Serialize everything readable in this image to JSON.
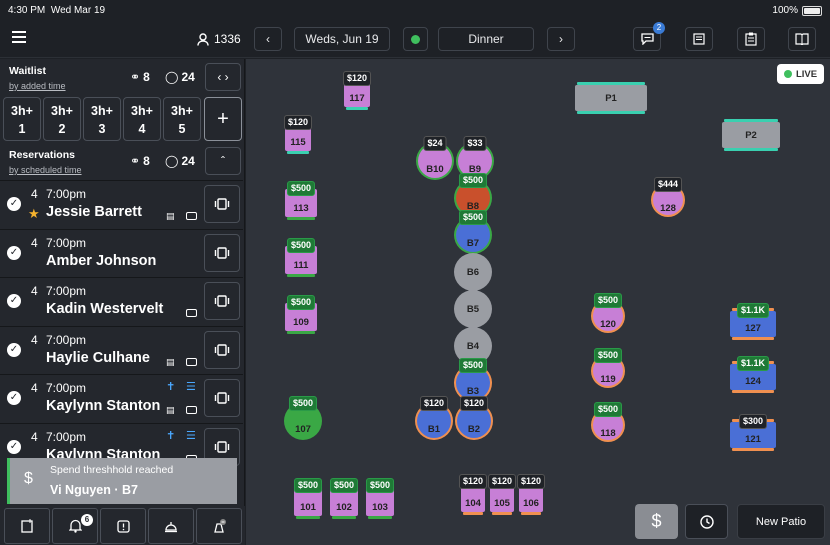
{
  "status": {
    "time": "4:30 PM",
    "date": "Wed Mar 19",
    "battery": "100%"
  },
  "topbar": {
    "menu_icon": "hamburger-icon",
    "covers": "1336",
    "date": "Weds, Jun 19",
    "service": "Dinner",
    "notif_badge": "2"
  },
  "waitlist": {
    "title": "Waitlist",
    "sort": "by added time",
    "parties": "8",
    "covers": "24",
    "slots": [
      {
        "top": "3h+",
        "bottom": "1"
      },
      {
        "top": "3h+",
        "bottom": "2"
      },
      {
        "top": "3h+",
        "bottom": "3"
      },
      {
        "top": "3h+",
        "bottom": "4"
      },
      {
        "top": "3h+",
        "bottom": "5"
      }
    ],
    "add": "+"
  },
  "reservations": {
    "title": "Reservations",
    "sort": "by scheduled time",
    "parties": "8",
    "covers": "24",
    "items": [
      {
        "size": "4",
        "time": "7:00pm",
        "name": "Jessie Barrett"
      },
      {
        "size": "4",
        "time": "7:00pm",
        "name": "Amber Johnson"
      },
      {
        "size": "4",
        "time": "7:00pm",
        "name": "Kadin Westervelt"
      },
      {
        "size": "4",
        "time": "7:00pm",
        "name": "Haylie Culhane"
      },
      {
        "size": "4",
        "time": "7:00pm",
        "name": "Kaylynn Stanton"
      },
      {
        "size": "4",
        "time": "7:00pm",
        "name": "Kaylynn Stanton"
      }
    ]
  },
  "toast": {
    "title": "Spend threshhold reached",
    "detail": "Vi Nguyen · B7",
    "icon": "$"
  },
  "bottomnav": {
    "badge": "6"
  },
  "floor": {
    "live": "LIVE",
    "tables": [
      {
        "id": "117",
        "price": "$120"
      },
      {
        "id": "115",
        "price": "$120"
      },
      {
        "id": "P1",
        "price": ""
      },
      {
        "id": "P2",
        "price": ""
      },
      {
        "id": "B10",
        "price": "$24"
      },
      {
        "id": "B9",
        "price": "$33"
      },
      {
        "id": "B8",
        "price": "$500"
      },
      {
        "id": "B7",
        "price": "$500"
      },
      {
        "id": "B6",
        "price": ""
      },
      {
        "id": "B5",
        "price": ""
      },
      {
        "id": "B4",
        "price": ""
      },
      {
        "id": "B3",
        "price": "$500"
      },
      {
        "id": "B1",
        "price": "$120"
      },
      {
        "id": "B2",
        "price": "$120"
      },
      {
        "id": "113",
        "price": "$500"
      },
      {
        "id": "111",
        "price": "$500"
      },
      {
        "id": "109",
        "price": "$500"
      },
      {
        "id": "107",
        "price": "$500"
      },
      {
        "id": "128",
        "price": "$444"
      },
      {
        "id": "120",
        "price": "$500"
      },
      {
        "id": "119",
        "price": "$500"
      },
      {
        "id": "118",
        "price": "$500"
      },
      {
        "id": "127",
        "price": "$1.1K"
      },
      {
        "id": "124",
        "price": "$1.1K"
      },
      {
        "id": "121",
        "price": "$300"
      },
      {
        "id": "101",
        "price": "$500"
      },
      {
        "id": "102",
        "price": "$500"
      },
      {
        "id": "103",
        "price": "$500"
      },
      {
        "id": "104",
        "price": "$120"
      },
      {
        "id": "105",
        "price": "$120"
      },
      {
        "id": "106",
        "price": "$120"
      }
    ],
    "dollar_btn": "$",
    "new_patio": "New Patio"
  },
  "colors": {
    "purple": "#c77fd6",
    "blue": "#4a6fd6",
    "green": "#3aa845",
    "grey": "#9a9da3",
    "red": "#c9502c",
    "teal": "#3ad0b0",
    "orange": "#f09050",
    "live": "#3fbf5e"
  }
}
